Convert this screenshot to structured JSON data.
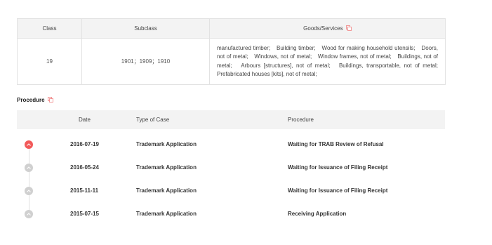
{
  "goods_table": {
    "headers": {
      "class": "Class",
      "subclass": "Subclass",
      "goods": "Goods/Services"
    },
    "row": {
      "class": "19",
      "subclass": "1901；1909；1910",
      "goods": "manufactured timber;　Building timber;　Wood for making household utensils;　Doors, not of metal;　Windows, not of metal;　Window frames, not of metal;　Buildings, not of metal;　Arbours [structures], not of metal;　Buildings, transportable, not of metal;　Prefabricated houses [kits], not of metal;"
    }
  },
  "procedure": {
    "title": "Procedure",
    "headers": {
      "date": "Date",
      "type": "Type of Case",
      "procedure": "Procedure"
    },
    "rows": [
      {
        "date": "2016-07-19",
        "type": "Trademark Application",
        "procedure": "Waiting for TRAB Review of Refusal",
        "status": "active"
      },
      {
        "date": "2016-05-24",
        "type": "Trademark Application",
        "procedure": "Waiting for Issuance of Filing Receipt",
        "status": "inactive"
      },
      {
        "date": "2015-11-11",
        "type": "Trademark Application",
        "procedure": "Waiting for Issuance of Filing Receipt",
        "status": "inactive"
      },
      {
        "date": "2015-07-15",
        "type": "Trademark Application",
        "procedure": "Receiving Application",
        "status": "inactive"
      }
    ]
  },
  "icons": {
    "copy": "copy-icon",
    "timeline_dot": "chevron-up-icon"
  },
  "colors": {
    "accent": "#f25a5a",
    "inactive_dot": "#d0d0d0",
    "header_bg": "#f3f3f3"
  }
}
